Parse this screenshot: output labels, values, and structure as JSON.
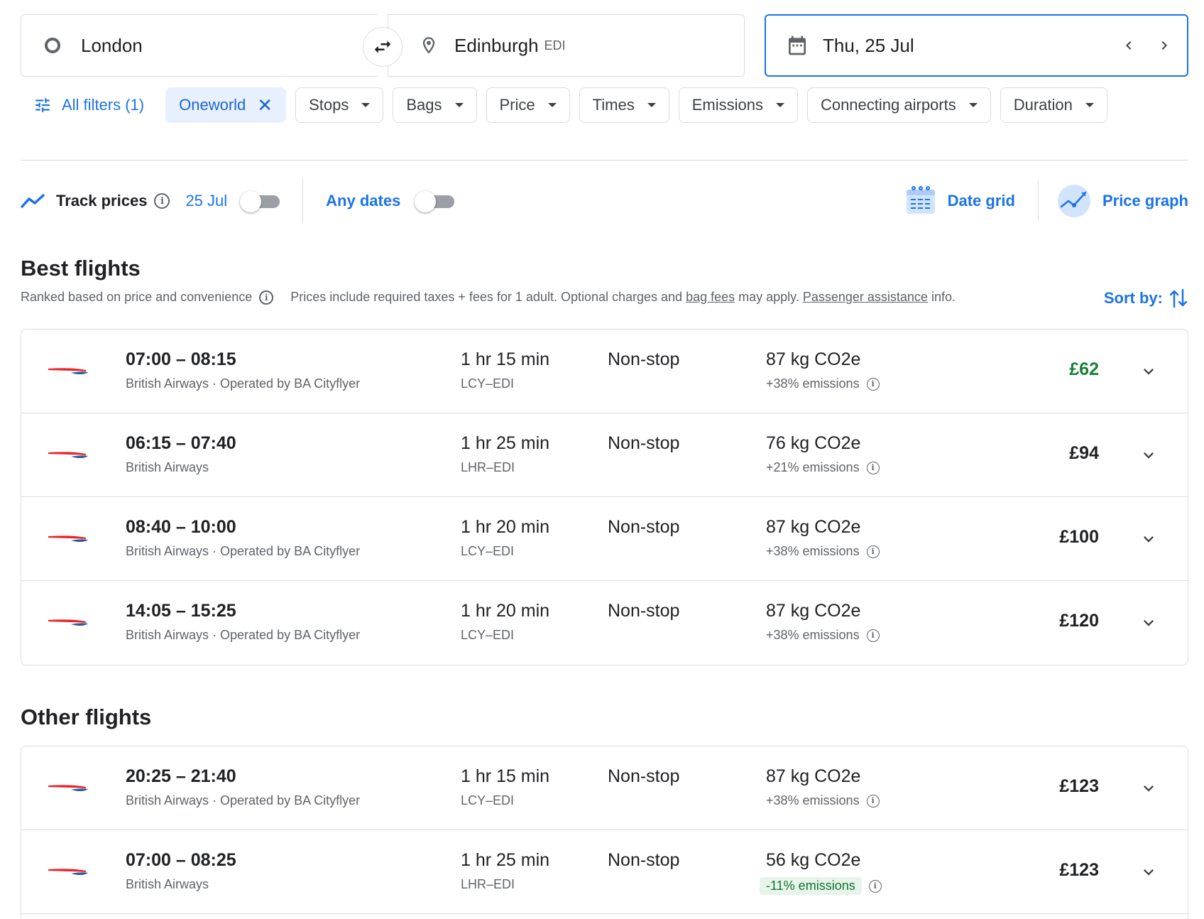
{
  "search": {
    "origin": "London",
    "destination": "Edinburgh",
    "destination_code": "EDI",
    "date": "Thu, 25 Jul"
  },
  "filters": {
    "all_filters_label": "All filters (1)",
    "active_chip": "Oneworld",
    "chips": [
      "Stops",
      "Bags",
      "Price",
      "Times",
      "Emissions",
      "Connecting airports",
      "Duration"
    ]
  },
  "track": {
    "label": "Track prices",
    "date": "25 Jul",
    "any_dates_label": "Any dates",
    "date_grid_label": "Date grid",
    "price_graph_label": "Price graph"
  },
  "best": {
    "title": "Best flights",
    "subtitle": "Ranked based on price and convenience",
    "disclaimer_pre": "Prices include required taxes + fees for 1 adult. Optional charges and ",
    "disclaimer_link1": "bag fees",
    "disclaimer_mid": " may apply. ",
    "disclaimer_link2": "Passenger assistance",
    "disclaimer_post": " info.",
    "sort_label": "Sort by:"
  },
  "other": {
    "title": "Other flights"
  },
  "colors": {
    "accent": "#1a73e8",
    "price_green": "#188038",
    "emission_green_bg": "#e6f4ea"
  },
  "best_flights": [
    {
      "times": "07:00 – 08:15",
      "airline": "British Airways · Operated by BA Cityflyer",
      "duration": "1 hr 15 min",
      "route": "LCY–EDI",
      "stops": "Non-stop",
      "co2": "87 kg CO2e",
      "emissions": "+38% emissions",
      "price": "£62"
    },
    {
      "times": "06:15 – 07:40",
      "airline": "British Airways",
      "duration": "1 hr 25 min",
      "route": "LHR–EDI",
      "stops": "Non-stop",
      "co2": "76 kg CO2e",
      "emissions": "+21% emissions",
      "price": "£94"
    },
    {
      "times": "08:40 – 10:00",
      "airline": "British Airways · Operated by BA Cityflyer",
      "duration": "1 hr 20 min",
      "route": "LCY–EDI",
      "stops": "Non-stop",
      "co2": "87 kg CO2e",
      "emissions": "+38% emissions",
      "price": "£100"
    },
    {
      "times": "14:05 – 15:25",
      "airline": "British Airways · Operated by BA Cityflyer",
      "duration": "1 hr 20 min",
      "route": "LCY–EDI",
      "stops": "Non-stop",
      "co2": "87 kg CO2e",
      "emissions": "+38% emissions",
      "price": "£120"
    }
  ],
  "other_flights": [
    {
      "times": "20:25 – 21:40",
      "airline": "British Airways · Operated by BA Cityflyer",
      "duration": "1 hr 15 min",
      "route": "LCY–EDI",
      "stops": "Non-stop",
      "co2": "87 kg CO2e",
      "emissions": "+38% emissions",
      "price": "£123"
    },
    {
      "times": "07:00 – 08:25",
      "airline": "British Airways",
      "duration": "1 hr 25 min",
      "route": "LHR–EDI",
      "stops": "Non-stop",
      "co2": "56 kg CO2e",
      "emissions": "-11% emissions",
      "price": "£123"
    }
  ]
}
